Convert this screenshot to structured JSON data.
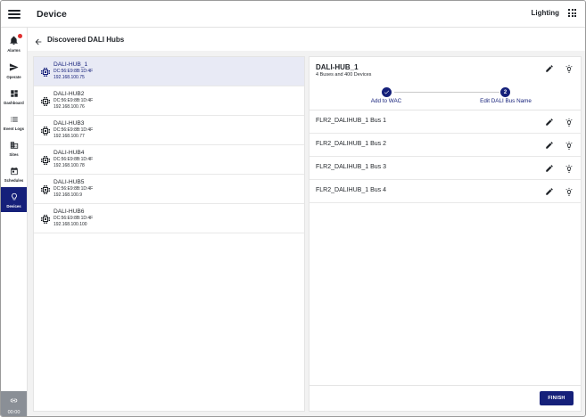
{
  "header": {
    "title": "Device",
    "context_label": "Lighting"
  },
  "sidebar": {
    "items": [
      {
        "label": "Alarms",
        "icon": "bell-icon",
        "badge": true
      },
      {
        "label": "Operate",
        "icon": "send-icon"
      },
      {
        "label": "Dashboard",
        "icon": "dashboard-icon"
      },
      {
        "label": "Event Logs",
        "icon": "list-icon"
      },
      {
        "label": "Sites",
        "icon": "building-icon"
      },
      {
        "label": "Schedules",
        "icon": "calendar-icon"
      },
      {
        "label": "Devices",
        "icon": "lightbulb-icon",
        "active": true
      }
    ],
    "timer": "00:00"
  },
  "page": {
    "title": "Discovered DALI Hubs"
  },
  "hubs": [
    {
      "name": "DALI-HUB_1",
      "mac": "DC:56:E9:8B:1D:4F",
      "ip": "192.168.100.75",
      "selected": true
    },
    {
      "name": "DALI-HUB2",
      "mac": "DC:56:E9:8B:1D:4F",
      "ip": "192.168.100.76"
    },
    {
      "name": "DALI-HUB3",
      "mac": "DC:56:E9:8B:1D:4F",
      "ip": "192.168.100.77"
    },
    {
      "name": "DALI-HUB4",
      "mac": "DC:56:E9:8B:1D:4F",
      "ip": "192.168.100.78"
    },
    {
      "name": "DALI-HUB5",
      "mac": "DC:56:E9:8B:1D:4F",
      "ip": "192.168.100.9"
    },
    {
      "name": "DALI-HUB6",
      "mac": "DC:56:E9:8B:1D:4F",
      "ip": "192.168.100.100"
    }
  ],
  "detail": {
    "title": "DALI-HUB_1",
    "subtitle": "4 Buses and 400 Devices",
    "steps": [
      {
        "label": "Add to WAC",
        "state": "done"
      },
      {
        "label": "Edit DALI Bus Name",
        "number": "2",
        "state": "current"
      }
    ],
    "buses": [
      {
        "name": "FLR2_DALIHUB_1 Bus 1"
      },
      {
        "name": "FLR2_DALIHUB_1 Bus 2"
      },
      {
        "name": "FLR2_DALIHUB_1 Bus 3"
      },
      {
        "name": "FLR2_DALIHUB_1 Bus 4"
      }
    ],
    "finish_label": "FINISH"
  },
  "colors": {
    "primary": "#15207a",
    "selected_row": "#e8eaf5",
    "badge": "#e03030",
    "background": "#f2f2f2"
  }
}
